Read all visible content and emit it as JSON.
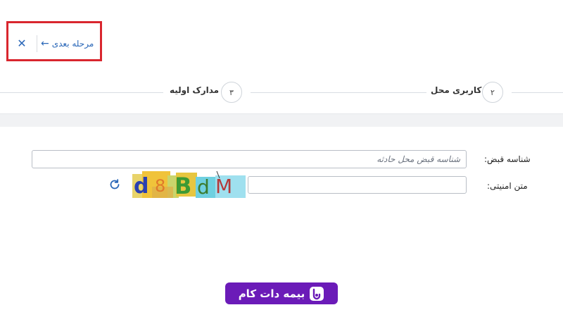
{
  "toolbar": {
    "close_icon": "close-icon",
    "next_label": "مرحله بعدی",
    "next_icon": "arrow-left-icon"
  },
  "stepper": {
    "steps": [
      {
        "number": "۲",
        "label": "کاربری محل"
      },
      {
        "number": "۳",
        "label": "مدارک اولیه"
      }
    ]
  },
  "form": {
    "receipt_id": {
      "label": "شناسه قبض:",
      "placeholder": "شناسه قبض محل حادثه",
      "value": ""
    },
    "captcha": {
      "label": "متن امنیتی:",
      "value": "",
      "image_text": "d8BdM",
      "refresh_icon": "refresh-icon"
    }
  },
  "brand": {
    "text": "بیمه دات کام",
    "color": "#6b1bb8"
  },
  "colors": {
    "accent": "#2a67b8",
    "highlight": "#d9262e"
  }
}
